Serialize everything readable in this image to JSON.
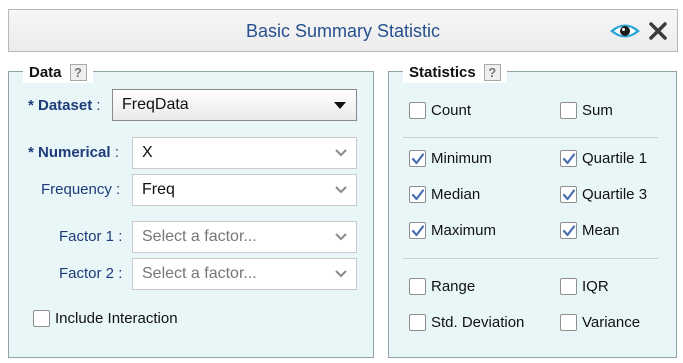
{
  "dialog": {
    "title": "Basic Summary Statistic"
  },
  "data_panel": {
    "legend": "Data",
    "help": "?",
    "dataset": {
      "required": "* Dataset",
      "colon": ":",
      "value": "FreqData"
    },
    "numerical": {
      "required": "* Numerical",
      "colon": ":",
      "value": "X"
    },
    "frequency": {
      "label": "Frequency",
      "colon": ":",
      "value": "Freq"
    },
    "factor1": {
      "label": "Factor 1",
      "colon": ":",
      "placeholder": "Select a factor..."
    },
    "factor2": {
      "label": "Factor 2",
      "colon": ":",
      "placeholder": "Select a factor..."
    },
    "interaction": {
      "label": "Include Interaction",
      "checked": false
    }
  },
  "stats_panel": {
    "legend": "Statistics",
    "help": "?",
    "items": [
      {
        "label": "Count",
        "checked": false
      },
      {
        "label": "Sum",
        "checked": false
      },
      {
        "label": "Minimum",
        "checked": true
      },
      {
        "label": "Quartile 1",
        "checked": true
      },
      {
        "label": "Median",
        "checked": true
      },
      {
        "label": "Quartile 3",
        "checked": true
      },
      {
        "label": "Maximum",
        "checked": true
      },
      {
        "label": "Mean",
        "checked": true
      },
      {
        "label": "Range",
        "checked": false
      },
      {
        "label": "IQR",
        "checked": false
      },
      {
        "label": "Std. Deviation",
        "checked": false
      },
      {
        "label": "Variance",
        "checked": false
      }
    ]
  },
  "colors": {
    "title": "#27508f",
    "label": "#1d3b78",
    "panel_bg": "#e9f6f8",
    "eye": "#2aa6d6",
    "check": "#4a6fae"
  }
}
